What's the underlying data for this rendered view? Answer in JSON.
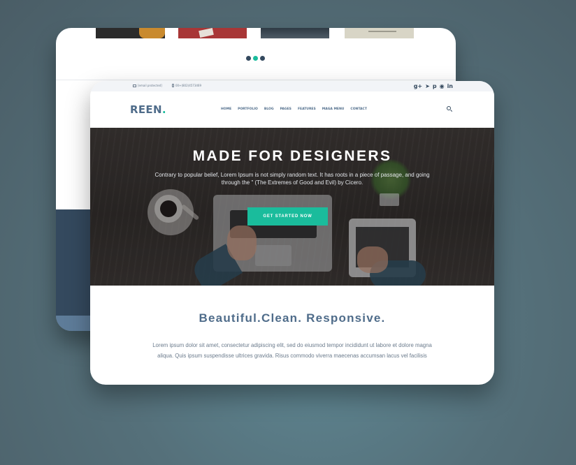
{
  "back_card": {
    "thumbnail_colors": [
      "#2a2a2a",
      "#b23a3a",
      "#2f3d4a",
      "#d8d6c8"
    ],
    "slider_dots": 3,
    "active_dot": 1
  },
  "topbar": {
    "email": "[email protected]",
    "phone": "00+(802)4573469",
    "socials": [
      "g+",
      "twitter",
      "p",
      "dribbble",
      "in"
    ]
  },
  "navbar": {
    "logo_text": "REEN",
    "logo_dot": ".",
    "menu": [
      "HOME",
      "PORTFOLIO",
      "BLOG",
      "PAGES",
      "FEATURES",
      "MAGA MENU",
      "CONTACT"
    ]
  },
  "hero": {
    "title": "MADE FOR DESIGNERS",
    "text": "Contrary to popular belief, Lorem Ipsum is not simply random text. It has roots in a piece of passage, and going through the \" (The Extremes of Good and Evil) by Cicero.",
    "cta_label": "GET STARTED NOW"
  },
  "content": {
    "title": "Beautiful.Clean. Responsive.",
    "text": "Lorem ipsum dolor sit amet, consectetur adipiscing elit, sed do eiusmod tempor incididunt ut labore et dolore magna aliqua. Quis ipsum suspendisse ultrices gravida. Risus commodo viverra maecenas accumsan lacus vel facilisis"
  },
  "colors": {
    "accent": "#1abc9c",
    "primary": "#4f6c8a",
    "dark": "#34495e"
  }
}
